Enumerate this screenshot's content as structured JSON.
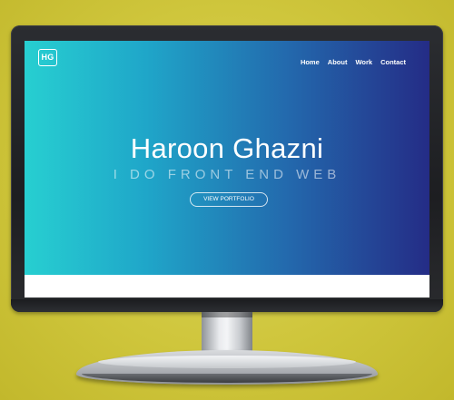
{
  "site": {
    "logo_text": "HG",
    "nav": [
      {
        "label": "Home"
      },
      {
        "label": "About"
      },
      {
        "label": "Work"
      },
      {
        "label": "Contact"
      }
    ]
  },
  "hero": {
    "title": "Haroon Ghazni",
    "subtitle": "I DO FRONT END WEB",
    "cta_label": "VIEW PORTFOLIO"
  },
  "colors": {
    "background": "#cfc63c",
    "gradient_start": "#27cfd1",
    "gradient_end": "#242c86",
    "bezel": "#1d1e21"
  }
}
